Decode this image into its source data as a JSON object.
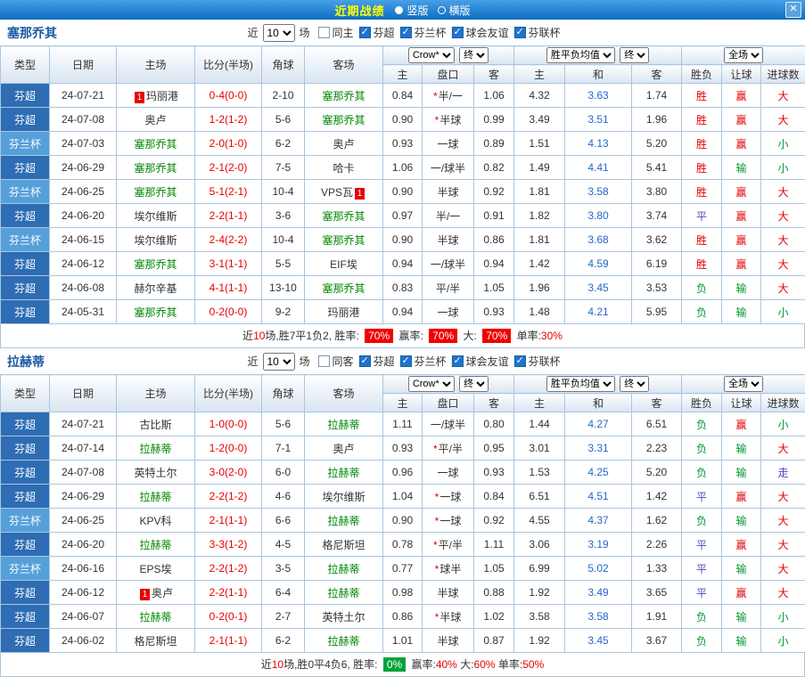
{
  "titlebar": {
    "title": "近期战绩",
    "options": [
      {
        "label": "竖版",
        "selected": true
      },
      {
        "label": "横版",
        "selected": false
      }
    ],
    "close_label": "✕"
  },
  "table_header": {
    "left_cols": [
      "类型",
      "日期",
      "主场",
      "比分(半场)",
      "角球",
      "客场"
    ],
    "asian_company": "Crow*",
    "asian_state": "终",
    "euro_company": "胜平负均值",
    "euro_state": "终",
    "scope": "全场",
    "sub_cols": [
      "主",
      "盘口",
      "客",
      "主",
      "和",
      "客",
      "胜负",
      "让球",
      "进球数"
    ]
  },
  "sections": [
    {
      "team": "塞那乔其",
      "filter": {
        "near": "近",
        "count": "10",
        "games": "场",
        "checkboxes": [
          {
            "label": "同主",
            "checked": false
          },
          {
            "label": "芬超",
            "checked": true
          },
          {
            "label": "芬兰杯",
            "checked": true
          },
          {
            "label": "球会友谊",
            "checked": true
          },
          {
            "label": "芬联杯",
            "checked": true
          }
        ]
      },
      "rows": [
        {
          "type": "芬超",
          "date": "24-07-21",
          "home": {
            "name": "玛丽港",
            "badge": "1",
            "badge_pos": "before"
          },
          "score": "0-4(0-0)",
          "corner": "2-10",
          "away": {
            "name": "塞那乔其",
            "green": true
          },
          "ah_home": "0.84",
          "ah_star": true,
          "ah_line": "半/一",
          "ah_away": "1.06",
          "eu_home": "4.32",
          "eu_draw": "3.63",
          "eu_away": "1.74",
          "result": "胜",
          "handicap": "赢",
          "goals": "大"
        },
        {
          "type": "芬超",
          "date": "24-07-08",
          "home": {
            "name": "奥卢"
          },
          "score": "1-2(1-2)",
          "corner": "5-6",
          "away": {
            "name": "塞那乔其",
            "green": true
          },
          "ah_home": "0.90",
          "ah_star": true,
          "ah_line": "半球",
          "ah_away": "0.99",
          "eu_home": "3.49",
          "eu_draw": "3.51",
          "eu_away": "1.96",
          "result": "胜",
          "handicap": "赢",
          "goals": "大"
        },
        {
          "type": "芬兰杯",
          "date": "24-07-03",
          "home": {
            "name": "塞那乔其",
            "green": true
          },
          "score": "2-0(1-0)",
          "corner": "6-2",
          "away": {
            "name": "奥卢"
          },
          "ah_home": "0.93",
          "ah_line": "一球",
          "ah_away": "0.89",
          "eu_home": "1.51",
          "eu_draw": "4.13",
          "eu_away": "5.20",
          "result": "胜",
          "handicap": "赢",
          "goals": "小"
        },
        {
          "type": "芬超",
          "date": "24-06-29",
          "home": {
            "name": "塞那乔其",
            "green": true
          },
          "score": "2-1(2-0)",
          "corner": "7-5",
          "away": {
            "name": "哈卡"
          },
          "ah_home": "1.06",
          "ah_line": "一/球半",
          "ah_away": "0.82",
          "eu_home": "1.49",
          "eu_draw": "4.41",
          "eu_away": "5.41",
          "result": "胜",
          "handicap": "输",
          "goals": "小"
        },
        {
          "type": "芬兰杯",
          "date": "24-06-25",
          "home": {
            "name": "塞那乔其",
            "green": true
          },
          "score": "5-1(2-1)",
          "corner": "10-4",
          "away": {
            "name": "VPS瓦",
            "badge": "1",
            "badge_pos": "after"
          },
          "ah_home": "0.90",
          "ah_line": "半球",
          "ah_away": "0.92",
          "eu_home": "1.81",
          "eu_draw": "3.58",
          "eu_away": "3.80",
          "result": "胜",
          "handicap": "赢",
          "goals": "大"
        },
        {
          "type": "芬超",
          "date": "24-06-20",
          "home": {
            "name": "埃尔维斯"
          },
          "score": "2-2(1-1)",
          "corner": "3-6",
          "away": {
            "name": "塞那乔其",
            "green": true
          },
          "ah_home": "0.97",
          "ah_line": "半/一",
          "ah_away": "0.91",
          "eu_home": "1.82",
          "eu_draw": "3.80",
          "eu_away": "3.74",
          "result": "平",
          "handicap": "赢",
          "goals": "大"
        },
        {
          "type": "芬兰杯",
          "date": "24-06-15",
          "home": {
            "name": "埃尔维斯"
          },
          "score": "2-4(2-2)",
          "corner": "10-4",
          "away": {
            "name": "塞那乔其",
            "green": true
          },
          "ah_home": "0.90",
          "ah_line": "半球",
          "ah_away": "0.86",
          "eu_home": "1.81",
          "eu_draw": "3.68",
          "eu_away": "3.62",
          "result": "胜",
          "handicap": "赢",
          "goals": "大"
        },
        {
          "type": "芬超",
          "date": "24-06-12",
          "home": {
            "name": "塞那乔其",
            "green": true
          },
          "score": "3-1(1-1)",
          "corner": "5-5",
          "away": {
            "name": "EIF埃"
          },
          "ah_home": "0.94",
          "ah_line": "一/球半",
          "ah_away": "0.94",
          "eu_home": "1.42",
          "eu_draw": "4.59",
          "eu_away": "6.19",
          "result": "胜",
          "handicap": "赢",
          "goals": "大"
        },
        {
          "type": "芬超",
          "date": "24-06-08",
          "home": {
            "name": "赫尔辛基"
          },
          "score": "4-1(1-1)",
          "corner": "13-10",
          "away": {
            "name": "塞那乔其",
            "green": true
          },
          "ah_home": "0.83",
          "ah_line": "平/半",
          "ah_away": "1.05",
          "eu_home": "1.96",
          "eu_draw": "3.45",
          "eu_away": "3.53",
          "result": "负",
          "handicap": "输",
          "goals": "大"
        },
        {
          "type": "芬超",
          "date": "24-05-31",
          "home": {
            "name": "塞那乔其",
            "green": true
          },
          "score": "0-2(0-0)",
          "corner": "9-2",
          "away": {
            "name": "玛丽港"
          },
          "ah_home": "0.94",
          "ah_line": "一球",
          "ah_away": "0.93",
          "eu_home": "1.48",
          "eu_draw": "4.21",
          "eu_away": "5.95",
          "result": "负",
          "handicap": "输",
          "goals": "小"
        }
      ],
      "summary": [
        {
          "t": "近",
          "s": "p"
        },
        {
          "t": "10",
          "s": "r"
        },
        {
          "t": "场,胜7平1负2, 胜率: ",
          "s": "p"
        },
        {
          "t": "70%",
          "s": "br"
        },
        {
          "t": " 赢率: ",
          "s": "p"
        },
        {
          "t": "70%",
          "s": "br"
        },
        {
          "t": " 大: ",
          "s": "p"
        },
        {
          "t": "70%",
          "s": "br"
        },
        {
          "t": " 单率:",
          "s": "p"
        },
        {
          "t": "30%",
          "s": "r"
        }
      ]
    },
    {
      "team": "拉赫蒂",
      "filter": {
        "near": "近",
        "count": "10",
        "games": "场",
        "checkboxes": [
          {
            "label": "同客",
            "checked": false
          },
          {
            "label": "芬超",
            "checked": true
          },
          {
            "label": "芬兰杯",
            "checked": true
          },
          {
            "label": "球会友谊",
            "checked": true
          },
          {
            "label": "芬联杯",
            "checked": true
          }
        ]
      },
      "rows": [
        {
          "type": "芬超",
          "date": "24-07-21",
          "home": {
            "name": "古比斯"
          },
          "score": "1-0(0-0)",
          "corner": "5-6",
          "away": {
            "name": "拉赫蒂",
            "green": true
          },
          "ah_home": "1.11",
          "ah_line": "一/球半",
          "ah_away": "0.80",
          "eu_home": "1.44",
          "eu_draw": "4.27",
          "eu_away": "6.51",
          "result": "负",
          "handicap": "赢",
          "goals": "小"
        },
        {
          "type": "芬超",
          "date": "24-07-14",
          "home": {
            "name": "拉赫蒂",
            "green": true
          },
          "score": "1-2(0-0)",
          "corner": "7-1",
          "away": {
            "name": "奥卢"
          },
          "ah_home": "0.93",
          "ah_star": true,
          "ah_line": "平/半",
          "ah_away": "0.95",
          "eu_home": "3.01",
          "eu_draw": "3.31",
          "eu_away": "2.23",
          "result": "负",
          "handicap": "输",
          "goals": "大"
        },
        {
          "type": "芬超",
          "date": "24-07-08",
          "home": {
            "name": "英特土尔"
          },
          "score": "3-0(2-0)",
          "corner": "6-0",
          "away": {
            "name": "拉赫蒂",
            "green": true
          },
          "ah_home": "0.96",
          "ah_line": "一球",
          "ah_away": "0.93",
          "eu_home": "1.53",
          "eu_draw": "4.25",
          "eu_away": "5.20",
          "result": "负",
          "handicap": "输",
          "goals": "走"
        },
        {
          "type": "芬超",
          "date": "24-06-29",
          "home": {
            "name": "拉赫蒂",
            "green": true
          },
          "score": "2-2(1-2)",
          "corner": "4-6",
          "away": {
            "name": "埃尔维斯"
          },
          "ah_home": "1.04",
          "ah_star": true,
          "ah_line": "一球",
          "ah_away": "0.84",
          "eu_home": "6.51",
          "eu_draw": "4.51",
          "eu_away": "1.42",
          "result": "平",
          "handicap": "赢",
          "goals": "大"
        },
        {
          "type": "芬兰杯",
          "date": "24-06-25",
          "home": {
            "name": "KPV科"
          },
          "score": "2-1(1-1)",
          "corner": "6-6",
          "away": {
            "name": "拉赫蒂",
            "green": true
          },
          "ah_home": "0.90",
          "ah_star": true,
          "ah_line": "一球",
          "ah_away": "0.92",
          "eu_home": "4.55",
          "eu_draw": "4.37",
          "eu_away": "1.62",
          "result": "负",
          "handicap": "输",
          "goals": "大"
        },
        {
          "type": "芬超",
          "date": "24-06-20",
          "home": {
            "name": "拉赫蒂",
            "green": true
          },
          "score": "3-3(1-2)",
          "corner": "4-5",
          "away": {
            "name": "格尼斯坦"
          },
          "ah_home": "0.78",
          "ah_star": true,
          "ah_line": "平/半",
          "ah_away": "1.11",
          "eu_home": "3.06",
          "eu_draw": "3.19",
          "eu_away": "2.26",
          "result": "平",
          "handicap": "赢",
          "goals": "大"
        },
        {
          "type": "芬兰杯",
          "date": "24-06-16",
          "home": {
            "name": "EPS埃"
          },
          "score": "2-2(1-2)",
          "corner": "3-5",
          "away": {
            "name": "拉赫蒂",
            "green": true
          },
          "ah_home": "0.77",
          "ah_star": true,
          "ah_line": "球半",
          "ah_away": "1.05",
          "eu_home": "6.99",
          "eu_draw": "5.02",
          "eu_away": "1.33",
          "result": "平",
          "handicap": "输",
          "goals": "大"
        },
        {
          "type": "芬超",
          "date": "24-06-12",
          "home": {
            "name": "奥卢",
            "badge": "1",
            "badge_pos": "before"
          },
          "score": "2-2(1-1)",
          "corner": "6-4",
          "away": {
            "name": "拉赫蒂",
            "green": true
          },
          "ah_home": "0.98",
          "ah_line": "半球",
          "ah_away": "0.88",
          "eu_home": "1.92",
          "eu_draw": "3.49",
          "eu_away": "3.65",
          "result": "平",
          "handicap": "赢",
          "goals": "大"
        },
        {
          "type": "芬超",
          "date": "24-06-07",
          "home": {
            "name": "拉赫蒂",
            "green": true
          },
          "score": "0-2(0-1)",
          "corner": "2-7",
          "away": {
            "name": "英特土尔"
          },
          "ah_home": "0.86",
          "ah_star": true,
          "ah_line": "半球",
          "ah_away": "1.02",
          "eu_home": "3.58",
          "eu_draw": "3.58",
          "eu_away": "1.91",
          "result": "负",
          "handicap": "输",
          "goals": "小"
        },
        {
          "type": "芬超",
          "date": "24-06-02",
          "home": {
            "name": "格尼斯坦"
          },
          "score": "2-1(1-1)",
          "corner": "6-2",
          "away": {
            "name": "拉赫蒂",
            "green": true
          },
          "ah_home": "1.01",
          "ah_line": "半球",
          "ah_away": "0.87",
          "eu_home": "1.92",
          "eu_draw": "3.45",
          "eu_away": "3.67",
          "result": "负",
          "handicap": "输",
          "goals": "小"
        }
      ],
      "summary": [
        {
          "t": "近",
          "s": "p"
        },
        {
          "t": "10",
          "s": "r"
        },
        {
          "t": "场,胜0平4负6, 胜率: ",
          "s": "p"
        },
        {
          "t": "0%",
          "s": "bg"
        },
        {
          "t": " 赢率:",
          "s": "p"
        },
        {
          "t": "40%",
          "s": "r"
        },
        {
          "t": " 大:",
          "s": "p"
        },
        {
          "t": "60%",
          "s": "r"
        },
        {
          "t": " 单率:",
          "s": "p"
        },
        {
          "t": "50%",
          "s": "r"
        }
      ]
    }
  ]
}
